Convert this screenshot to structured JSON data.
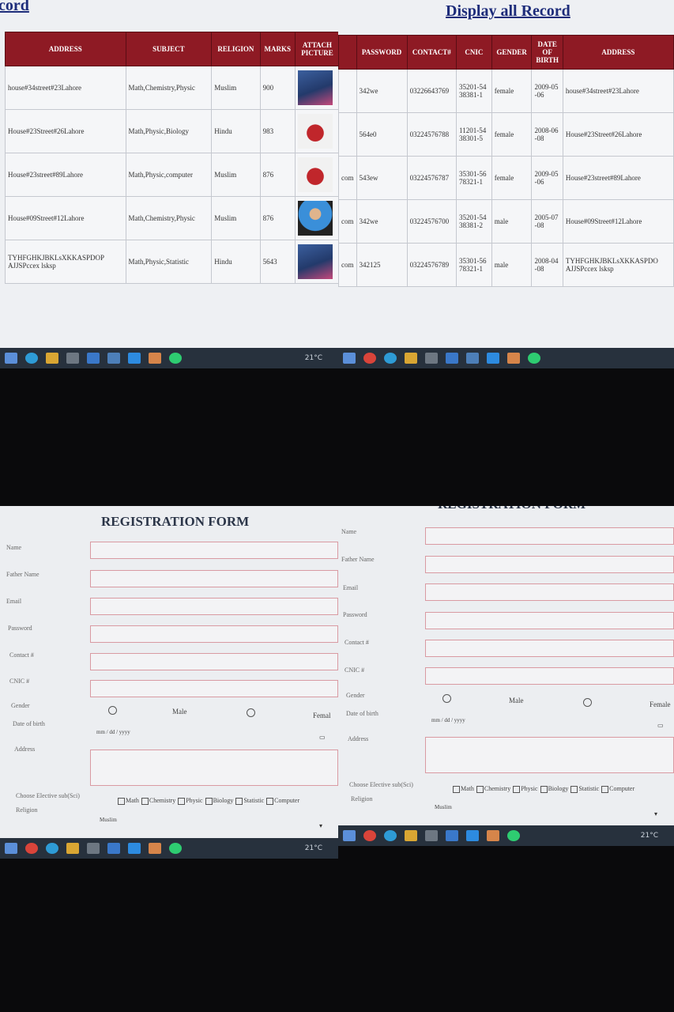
{
  "panel1": {
    "title": "cord",
    "headers": [
      "ADDRESS",
      "SUBJECT",
      "RELIGION",
      "MARKS",
      "ATTACH PICTURE"
    ],
    "rows": [
      {
        "address": "house#34street#23Lahore",
        "subject": "Math,Chemistry,Physic",
        "religion": "Muslim",
        "marks": "900",
        "pic": "person-photo"
      },
      {
        "address": "House#23Street#26Lahore",
        "subject": "Math,Physic,Biology",
        "religion": "Hindu",
        "marks": "983",
        "pic": "parrot-photo"
      },
      {
        "address": "House#23street#89Lahore",
        "subject": "Math,Physic,computer",
        "religion": "Muslim",
        "marks": "876",
        "pic": "parrot-photo"
      },
      {
        "address": "House#09Street#12Lahore",
        "subject": "Math,Chemistry,Physic",
        "religion": "Muslim",
        "marks": "876",
        "pic": "man-photo"
      },
      {
        "address": "TYHFGHKJBKLsXKKASPDOP AJJSPccex lsksp",
        "subject": "Math,Physic,Statistic",
        "religion": "Hindu",
        "marks": "5643",
        "pic": "person-photo"
      }
    ],
    "weather": "21°C"
  },
  "panel2": {
    "title": "Display all Record",
    "headers": [
      "PASSWORD",
      "CONTACT#",
      "CNIC",
      "GENDER",
      "DATE OF BIRTH",
      "ADDRESS"
    ],
    "rows": [
      {
        "prefix": "",
        "password": "342we",
        "contact": "03226643769",
        "cnic": "35201-5438381-1",
        "gender": "female",
        "dob": "2009-05-06",
        "address": "house#34street#23Lahore"
      },
      {
        "prefix": "",
        "password": "564e0",
        "contact": "03224576788",
        "cnic": "11201-5438301-5",
        "gender": "female",
        "dob": "2008-06-08",
        "address": "House#23Street#26Lahore"
      },
      {
        "prefix": "com",
        "password": "543ew",
        "contact": "03224576787",
        "cnic": "35301-5678321-1",
        "gender": "female",
        "dob": "2009-05-06",
        "address": "House#23street#89Lahore"
      },
      {
        "prefix": "com",
        "password": "342we",
        "contact": "03224576700",
        "cnic": "35201-5438381-2",
        "gender": "male",
        "dob": "2005-07-08",
        "address": "House#09Street#12Lahore"
      },
      {
        "prefix": "com",
        "password": "342125",
        "contact": "03224576789",
        "cnic": "35301-5678321-1",
        "gender": "male",
        "dob": "2008-04-08",
        "address": "TYHFGHKJBKLsXKKASPDO AJJSPccex lsksp"
      }
    ]
  },
  "form": {
    "title": "REGISTRATION FORM",
    "labels": {
      "name": "Name",
      "father": "Father Name",
      "email": "Email",
      "password": "Password",
      "contact": "Contact #",
      "cnic": "CNIC #",
      "gender": "Gender",
      "dob": "Date of birth",
      "address": "Address",
      "elective": "Choose Elective sub(Sci)",
      "religion": "Religion"
    },
    "gender_male": "Male",
    "gender_female_p3": "Femal",
    "gender_female_p4": "Female",
    "dob_placeholder": "mm / dd / yyyy",
    "subjects": [
      "Math",
      "Chemistry",
      "Physic",
      "Biology",
      "Statistic",
      "Computer"
    ],
    "religion_value": "Muslim",
    "weather": "21°C"
  },
  "colors": {
    "header_bg": "#8e1a24",
    "title": "#1d2c7a",
    "input_border": "#d99aa2",
    "taskbar": "#27313d"
  }
}
